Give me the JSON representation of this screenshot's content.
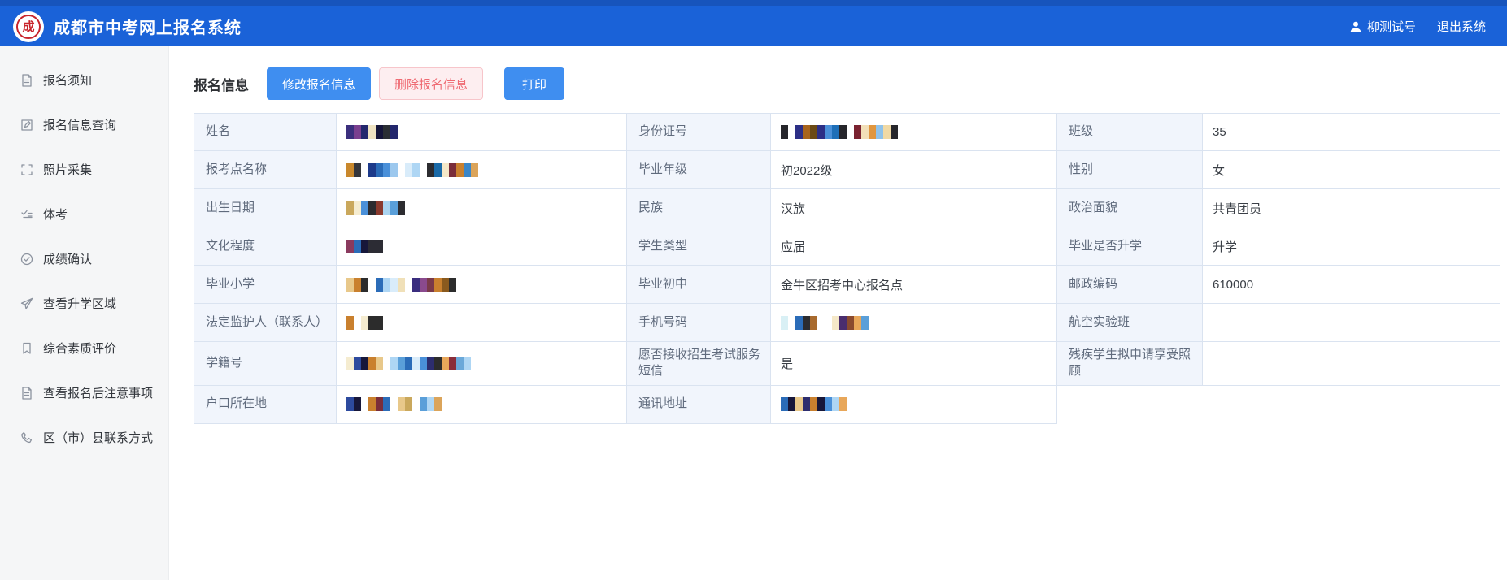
{
  "header": {
    "app_title": "成都市中考网上报名系统",
    "logo_text": "成",
    "username": "柳测试号",
    "logout_label": "退出系统"
  },
  "sidebar": {
    "items": [
      {
        "key": "registration-notice",
        "label": "报名须知",
        "icon": "document-icon"
      },
      {
        "key": "registration-info-query",
        "label": "报名信息查询",
        "icon": "edit-square-icon"
      },
      {
        "key": "photo-collection",
        "label": "照片采集",
        "icon": "scan-icon"
      },
      {
        "key": "physical-exam",
        "label": "体考",
        "icon": "checklist-icon"
      },
      {
        "key": "score-confirmation",
        "label": "成绩确认",
        "icon": "check-circle-icon"
      },
      {
        "key": "view-enrollment-area",
        "label": "查看升学区域",
        "icon": "send-icon"
      },
      {
        "key": "quality-evaluation",
        "label": "综合素质评价",
        "icon": "bookmark-icon"
      },
      {
        "key": "post-registration-notes",
        "label": "查看报名后注意事项",
        "icon": "document-icon"
      },
      {
        "key": "district-contact-info",
        "label": "区（市）县联系方式",
        "icon": "phone-icon"
      }
    ]
  },
  "main": {
    "page_title": "报名信息",
    "toolbar": {
      "edit_label": "修改报名信息",
      "delete_label": "删除报名信息",
      "print_label": "打印"
    },
    "table_rows": [
      [
        {
          "key": "name",
          "label": "姓名",
          "mosaic": [
            "#3b2f7d",
            "#7a3f8f",
            "#23276d",
            "#efe3c2",
            "#15153a",
            "#2a2e33",
            "#23276d"
          ]
        },
        {
          "key": "id-number",
          "label": "身份证号",
          "mosaic": [
            "#26262b",
            "",
            "#2c2f86",
            "#a8641c",
            "#6b4a14",
            "#2c2f86",
            "#4a90d9",
            "#1e6fb8",
            "#26262b",
            "",
            "#7a2230",
            "#f2dfb8",
            "#e0963f",
            "#8fc2ea",
            "#f0d9a4",
            "#26262b"
          ]
        },
        {
          "key": "class",
          "label": "班级",
          "value": "35"
        }
      ],
      [
        {
          "key": "reg-point",
          "label": "报考点名称",
          "mosaic": [
            "#c9882c",
            "#35363b",
            "",
            "#1d3a8a",
            "#2b6cb8",
            "#4a90d9",
            "#9cc8ee",
            "",
            "#d9ecfa",
            "#aed6f4",
            "",
            "#2c2c30",
            "#1a6aa8",
            "#f5e8c8",
            "#7a2d3a",
            "#c9802e",
            "#3a86c8",
            "#dba45a"
          ]
        },
        {
          "key": "graduation-grade",
          "label": "毕业年级",
          "value": "初2022级"
        },
        {
          "key": "gender",
          "label": "性别",
          "value": "女"
        }
      ],
      [
        {
          "key": "birth-date",
          "label": "出生日期",
          "mosaic": [
            "#caa85c",
            "#f5ecd0",
            "#4a90d9",
            "#2c2c30",
            "#8a3a2e",
            "#aad4f0",
            "#5a9fd9",
            "#2c2c30"
          ]
        },
        {
          "key": "ethnicity",
          "label": "民族",
          "value": "汉族"
        },
        {
          "key": "political-status",
          "label": "政治面貌",
          "value": "共青团员"
        }
      ],
      [
        {
          "key": "education-level",
          "label": "文化程度",
          "mosaic": [
            "#8a3a5e",
            "#2b6cb8",
            "#17173a",
            "#2c2c34",
            "#2c2c34"
          ]
        },
        {
          "key": "student-type",
          "label": "学生类型",
          "value": "应届"
        },
        {
          "key": "further-study",
          "label": "毕业是否升学",
          "value": "升学"
        }
      ],
      [
        {
          "key": "primary-school",
          "label": "毕业小学",
          "mosaic": [
            "#e8c88a",
            "#c9802e",
            "#2c2c2c",
            "",
            "#2b6cb8",
            "#aed6f4",
            "#d9ecfa",
            "#f0e0b8",
            "",
            "#3a2d7e",
            "#8a4a8e",
            "#7a3a4a",
            "#c9802e",
            "#8a5a1e",
            "#2c2c2c"
          ]
        },
        {
          "key": "junior-high",
          "label": "毕业初中",
          "value": "金牛区招考中心报名点"
        },
        {
          "key": "postal-code",
          "label": "邮政编码",
          "value": "610000"
        }
      ],
      [
        {
          "key": "guardian",
          "label": "法定监护人（联系人）",
          "mosaic": [
            "#c9802e",
            "",
            "#f5ecd0",
            "#2c2c2c",
            "#2c2c2c"
          ]
        },
        {
          "key": "phone",
          "label": "手机号码",
          "mosaic": [
            "#d9f0f5",
            "",
            "#2b6cb8",
            "#2c2c30",
            "#a86a2e",
            "",
            "",
            "#f5e8c8",
            "#4a2d6e",
            "#8a4a2e",
            "#e8a75a",
            "#5a9fd9"
          ]
        },
        {
          "key": "aviation-class",
          "label": "航空实验班",
          "value": ""
        }
      ],
      [
        {
          "key": "student-id",
          "label": "学籍号",
          "mosaic": [
            "#f5ecd0",
            "#2d4a9e",
            "#17173a",
            "#c9802e",
            "#e8c88a",
            "",
            "#aed6f4",
            "#5a9fd9",
            "#2b6cb8",
            "#d9ecfa",
            "#4a90d9",
            "#2d2d6e",
            "#2c2c2c",
            "#e8a75a",
            "#8a2d3a",
            "#6aa8d9",
            "#aed6f4"
          ]
        },
        {
          "key": "sms-consent",
          "label": "愿否接收招生考试服务短信",
          "value": "是"
        },
        {
          "key": "disability-care",
          "label": "残疾学生拟申请享受照顾",
          "value": ""
        }
      ],
      [
        {
          "key": "residence",
          "label": "户口所在地",
          "mosaic": [
            "#2d4a9e",
            "#17173a",
            "",
            "#c9802e",
            "#7a2d3a",
            "#2b6cb8",
            "",
            "#e8c88a",
            "#caa85c",
            "",
            "#5a9fd9",
            "#aed6f4",
            "#dba45a"
          ]
        },
        {
          "key": "mailing-address",
          "label": "通讯地址",
          "mosaic": [
            "#2b6cb8",
            "#17173a",
            "#e8c88a",
            "#2d2d6e",
            "#c9802e",
            "#17173a",
            "#4a90d9",
            "#aed6f4",
            "#e8a75a"
          ]
        }
      ]
    ]
  },
  "colors": {
    "header_blue": "#1a62d8",
    "header_top_strip": "#1754bc",
    "primary_button": "#3f8ef0",
    "danger_button_bg": "#fdeef0",
    "danger_button_border": "#f7c5ca",
    "danger_button_text": "#ef6a72",
    "label_cell_bg": "#f1f5fc",
    "table_border": "#dae3f0",
    "sidebar_bg": "#f5f6f7",
    "logo_red": "#c8242c"
  }
}
